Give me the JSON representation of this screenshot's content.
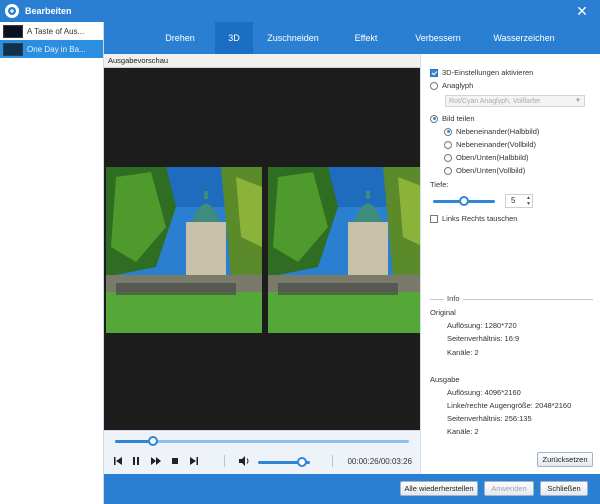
{
  "window": {
    "title": "Bearbeiten",
    "close_label": "✕"
  },
  "files": [
    {
      "name": "A Taste of Aus...",
      "selected": false
    },
    {
      "name": "One Day in Ba...",
      "selected": true
    }
  ],
  "tabs": [
    "Drehen",
    "3D",
    "Zuschneiden",
    "Effekt",
    "Verbessern",
    "Wasserzeichen"
  ],
  "active_tab": "3D",
  "preview": {
    "header": "Ausgabevorschau",
    "watermark": "one-culture.de",
    "seek_fraction": 0.13,
    "volume_fraction": 0.85,
    "time": "00:00:26/00:03:26"
  },
  "settings3d": {
    "enable_label": "3D-Einstellungen aktivieren",
    "enabled": true,
    "anaglyph_label": "Anaglyph",
    "anaglyph_select": "Rot/Cyan Anaglyph, Vollfarbe",
    "split_label": "Bild teilen",
    "split_options": [
      "Nebeneinander(Halbbild)",
      "Nebeneinander(Vollbild)",
      "Oben/Unten(Halbbild)",
      "Oben/Unten(Vollbild)"
    ],
    "selected_split": 0,
    "depth_label": "Tiefe:",
    "depth_value": "5",
    "depth_fraction": 0.5,
    "swap_label": "Links Rechts tauschen",
    "swap_checked": false
  },
  "info": {
    "legend": "Info",
    "original_title": "Original",
    "original": [
      "Auflösung: 1280*720",
      "Seitenverhältnis: 16:9",
      "Kanäle: 2"
    ],
    "output_title": "Ausgabe",
    "output": [
      "Auflösung: 4096*2160",
      "Linke/rechte Augengröße: 2048*2160",
      "Seitenverhältnis: 256:135",
      "Kanäle: 2"
    ]
  },
  "buttons": {
    "reset": "Zurücksetzen",
    "restore_all": "Alle wiederherstellen",
    "apply": "Anwenden",
    "close": "Schließen"
  },
  "colors": {
    "accent": "#2a7fd2",
    "accent_dark": "#1b6ec3",
    "slider": "#2f86d6"
  }
}
